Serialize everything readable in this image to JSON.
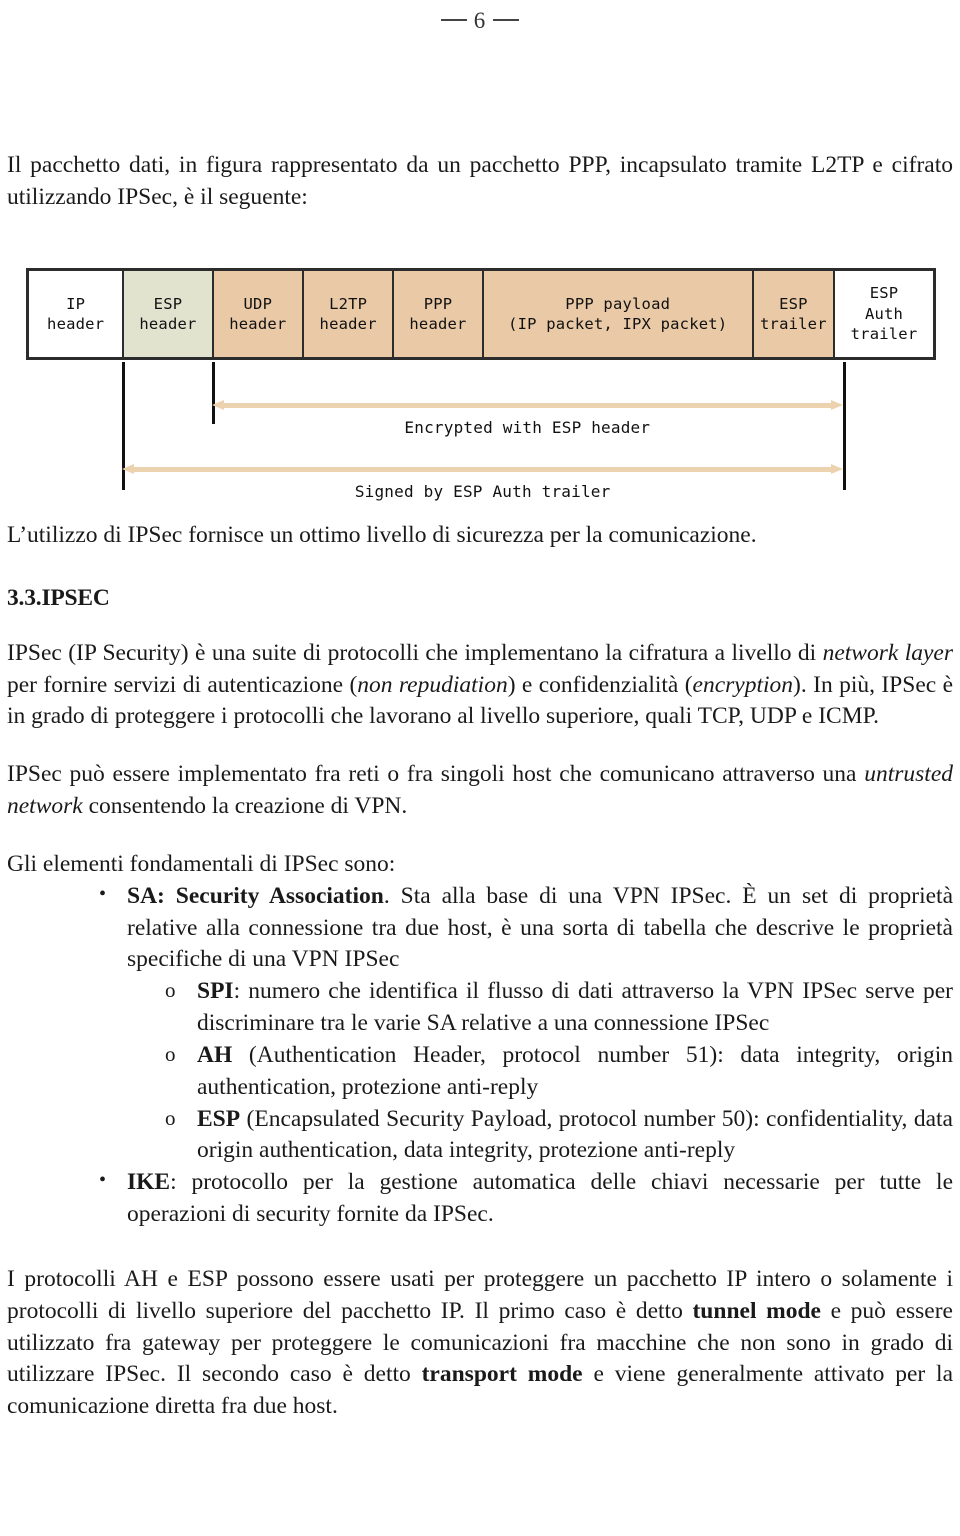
{
  "header": {
    "page_number": "6"
  },
  "intro": {
    "text": "Il pacchetto dati, in figura rappresentato da un pacchetto PPP, incapsulato tramite L2TP e cifrato utilizzando IPSec, è il seguente:"
  },
  "diagram": {
    "name": "packet-encapsulation-diagram",
    "cells": [
      {
        "lines": [
          "IP",
          "header"
        ],
        "fill": "#ffffff",
        "width_pct": 10.55
      },
      {
        "lines": [
          "ESP",
          "header"
        ],
        "fill": "#e2e3cf",
        "width_pct": 9.9
      },
      {
        "lines": [
          "UDP",
          "header"
        ],
        "fill": "#eac9a6",
        "width_pct": 10.0
      },
      {
        "lines": [
          "L2TP",
          "header"
        ],
        "fill": "#eac9a6",
        "width_pct": 10.0
      },
      {
        "lines": [
          "PPP",
          "header"
        ],
        "fill": "#eac9a6",
        "width_pct": 9.9
      },
      {
        "lines": [
          "PPP payload",
          "(IP packet, IPX packet)"
        ],
        "fill": "#eac9a6",
        "width_pct": 29.9
      },
      {
        "lines": [
          "ESP",
          "trailer"
        ],
        "fill": "#eac9a6",
        "width_pct": 9.0
      },
      {
        "lines": [
          "ESP",
          "Auth",
          "trailer"
        ],
        "fill": "#ffffff",
        "width_pct": 10.85
      }
    ],
    "arrows": [
      {
        "label": "Encrypted with ESP header",
        "start_pct": 20.4,
        "end_pct": 89.8
      },
      {
        "label": "Signed by ESP Auth trailer",
        "start_pct": 10.6,
        "end_pct": 89.8
      }
    ],
    "accent_color": "#edd2b0",
    "border_color": "#2c2c2c"
  },
  "para_security": {
    "text": "L’utilizzo di IPSec fornisce un ottimo livello di sicurezza per la comunicazione."
  },
  "section": {
    "heading": "3.3.IPSEC"
  },
  "para_ipsec_1": {
    "seg_1": "IPSec (IP Security) è una suite di protocolli che implementano la cifratura a livello di ",
    "em_1": "network layer",
    "seg_2": " per fornire servizi di autenticazione (",
    "em_2": "non repudiation",
    "seg_3": ") e confidenzialità (",
    "em_3": "encryption",
    "seg_4": "). In più, IPSec è in grado di proteggere i protocolli che lavorano al livello superiore, quali TCP, UDP e ICMP."
  },
  "para_ipsec_2": {
    "seg_1": "IPSec può essere implementato fra reti o fra singoli host che comunicano attraverso una ",
    "em_1": "untrusted network",
    "seg_2": " consentendo la creazione di VPN."
  },
  "list_lead_in": {
    "text": "Gli elementi fondamentali di IPSec sono:"
  },
  "list": {
    "bullet_marker": "•",
    "circle_marker": "o",
    "items": [
      {
        "term": "SA: Security Association",
        "rest": ". Sta alla base di una VPN IPSec. È un set di proprietà relative alla connessione tra due host, è una sorta di tabella che descrive le proprietà specifiche di una VPN IPSec",
        "children": [
          {
            "term": "SPI",
            "rest": ": numero che identifica il flusso di dati attraverso la VPN IPSec serve per discriminare tra le varie SA relative a una connessione IPSec"
          },
          {
            "term": "AH",
            "rest": " (Authentication Header, protocol number 51): data integrity, origin authentication, protezione anti-reply"
          },
          {
            "term": "ESP",
            "rest": " (Encapsulated Security Payload, protocol number 50): confidentiality, data origin authentication, data integrity, protezione anti-reply"
          }
        ]
      },
      {
        "term": "IKE",
        "rest": ": protocollo per la gestione automatica delle chiavi necessarie per tutte le operazioni di security fornite da IPSec.",
        "children": []
      }
    ]
  },
  "para_final": {
    "seg_1": "I protocolli AH e ESP possono essere usati per proteggere un pacchetto IP intero o solamente i protocolli di livello superiore del pacchetto IP. Il primo caso è detto ",
    "strong_1": "tunnel mode",
    "seg_2": " e può essere utilizzato fra gateway per proteggere le comunicazioni fra macchine che non sono in grado di utilizzare IPSec. Il secondo caso è detto ",
    "strong_2": "transport mode",
    "seg_3": " e viene generalmente attivato per la comunicazione diretta fra due host."
  }
}
